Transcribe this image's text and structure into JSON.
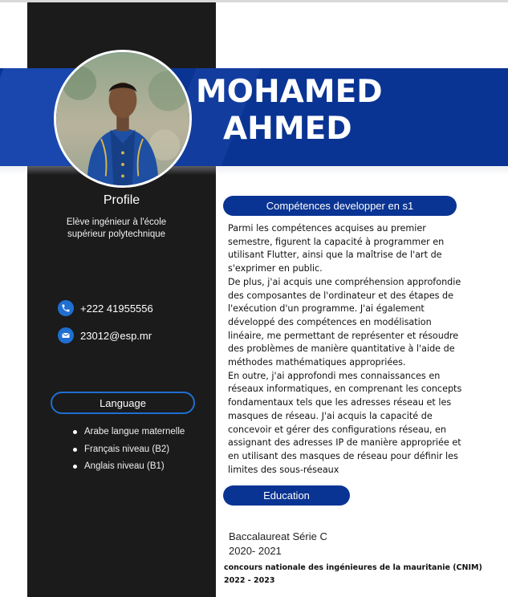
{
  "header": {
    "first_name": "MOHAMED",
    "last_name": "AHMED"
  },
  "sidebar": {
    "profile_title": "Profile",
    "profile_text": "Elève ingénieur à l'école supérieur polytechnique",
    "phone": "+222 41955556",
    "email": "23012@esp.mr",
    "language_title": "Language",
    "languages": [
      "Arabe langue maternelle",
      "Français niveau (B2)",
      "Anglais niveau (B1)"
    ]
  },
  "skills": {
    "title": "Compétences developper en s1",
    "paragraphs": [
      "Parmi les compétences acquises au premier semestre, figurent la capacité à programmer en utilisant Flutter, ainsi que la maîtrise de l'art de s'exprimer en public.",
      "De plus, j'ai acquis une compréhension approfondie des composantes de l'ordinateur et des étapes de l'exécution d'un programme. J'ai également développé des compétences en modélisation linéaire, me permettant de représenter et résoudre des problèmes de manière quantitative à l'aide de méthodes mathématiques appropriées.",
      "En outre, j'ai approfondi mes connaissances en réseaux informatiques, en comprenant les concepts fondamentaux tels que les adresses réseau et les masques de réseau. J'ai acquis la capacité de concevoir et gérer des configurations réseau, en assignant des adresses IP de manière appropriée et en utilisant des masques de réseau pour définir les limites des sous-réseaux"
    ]
  },
  "education": {
    "title": "Education",
    "items": [
      {
        "name": "Baccalaureat Série C",
        "years": "2020- 2021"
      },
      {
        "name": "concours nationale des ingénieures de la mauritanie (CNIM)",
        "years": "2022 - 2023"
      }
    ]
  },
  "colors": {
    "primary_blue": "#0a3493",
    "sidebar_dark": "#1b1b1b",
    "accent_blue": "#1f6fd1"
  },
  "icons": {
    "phone": "phone-icon",
    "email": "email-icon"
  }
}
